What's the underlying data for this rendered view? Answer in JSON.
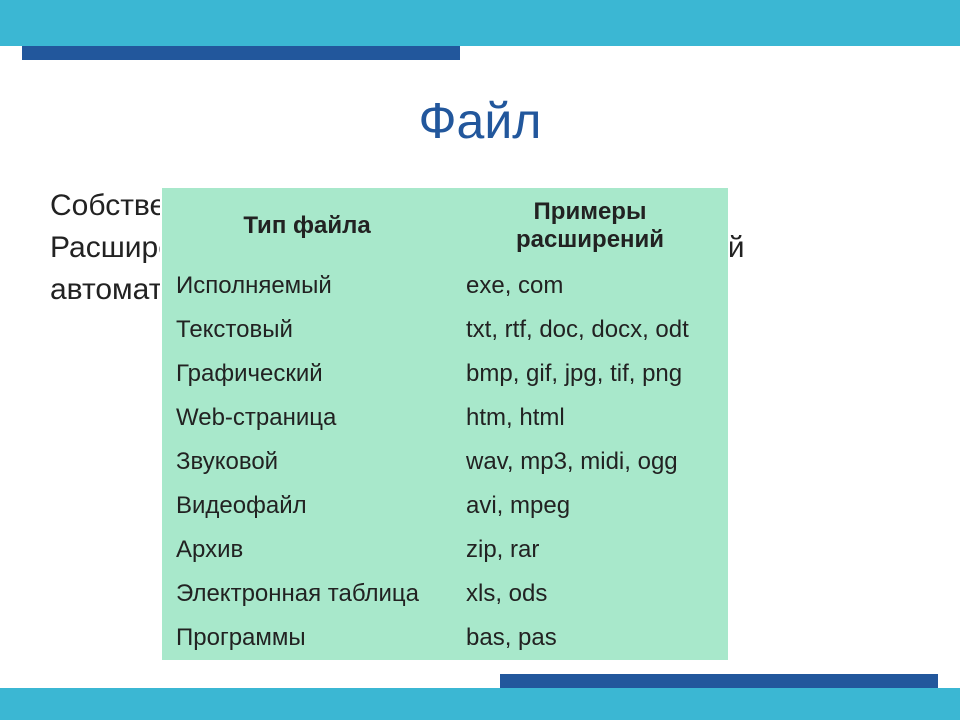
{
  "title": "Файл",
  "background_text": {
    "line1": "Собственно имя файлу даёт пользователь.",
    "line2": "Расширение имени обычно задаётся программой",
    "line3": "автоматически при создании файла."
  },
  "chart_data": {
    "type": "table",
    "headers": [
      "Тип файла",
      "Примеры расширений"
    ],
    "rows": [
      {
        "type": "Исполняемый",
        "ext": "exe, com"
      },
      {
        "type": "Текстовый",
        "ext": "txt, rtf, doc, docx, odt"
      },
      {
        "type": "Графический",
        "ext": "bmp, gif, jpg, tif, png"
      },
      {
        "type": "Web-страница",
        "ext": "htm, html"
      },
      {
        "type": "Звуковой",
        "ext": "wav, mp3, midi, ogg"
      },
      {
        "type": "Видеофайл",
        "ext": "avi, mpeg"
      },
      {
        "type": "Архив",
        "ext": "zip, rar"
      },
      {
        "type": "Электронная таблица",
        "ext": "xls, ods"
      },
      {
        "type": "Программы",
        "ext": "bas, pas"
      }
    ]
  },
  "colors": {
    "bar": "#3bb7d3",
    "accent": "#22579c",
    "table_bg": "#a8e8cb"
  }
}
